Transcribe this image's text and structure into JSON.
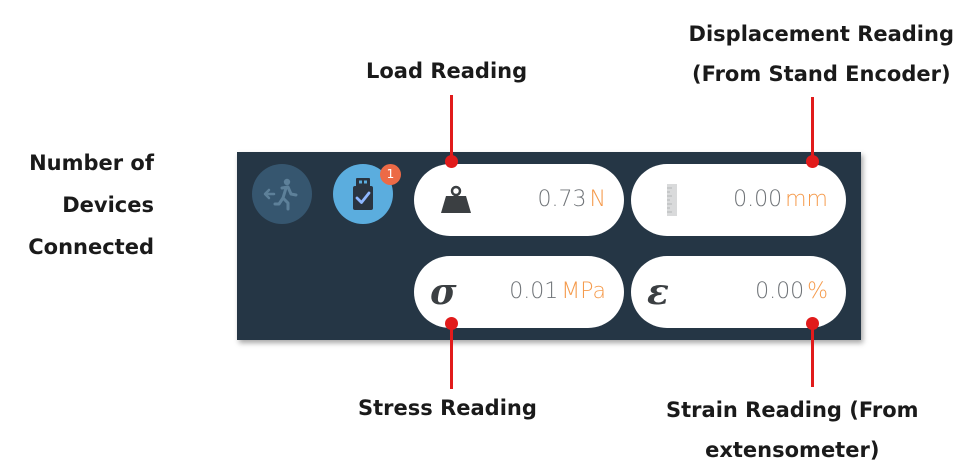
{
  "annotations": {
    "load": "Load Reading",
    "devices": [
      "Number of",
      "Devices",
      "Connected"
    ],
    "displacement": [
      "Displacement Reading",
      "(From Stand Encoder)"
    ],
    "stress": "Stress Reading",
    "strain": [
      "Strain Reading (From",
      "extensometer)"
    ]
  },
  "toolbar": {
    "exit_icon": "exit-door-icon",
    "usb_icon": "usb-device-check-icon",
    "devices_connected": "1"
  },
  "readings": {
    "load": {
      "icon": "weight-icon",
      "value": "0.73",
      "unit": "N"
    },
    "displacement": {
      "icon": "ruler-icon",
      "value": "0.00",
      "unit": "mm"
    },
    "stress": {
      "symbol": "σ",
      "value": "0.01",
      "unit": "MPa"
    },
    "strain": {
      "symbol": "ε",
      "value": "0.00",
      "unit": "%"
    }
  },
  "colors": {
    "panel": "#253645",
    "accent_unit": "#f59a4b",
    "callout": "#e11b1b",
    "badge": "#ec6a46",
    "usb_button": "#5badde",
    "exit_button": "#36566f"
  }
}
